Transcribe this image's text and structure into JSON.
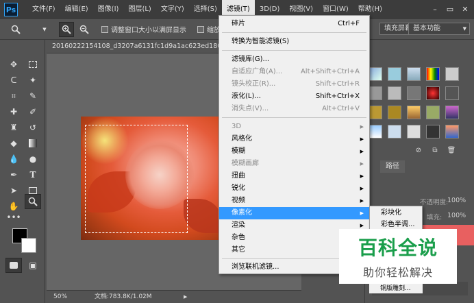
{
  "app": {
    "logo": "Ps"
  },
  "menubar": {
    "items": [
      "文件(F)",
      "编辑(E)",
      "图像(I)",
      "图层(L)",
      "文字(Y)",
      "选择(S)",
      "滤镜(T)",
      "3D(D)",
      "视图(V)",
      "窗口(W)",
      "帮助(H)"
    ],
    "active_index": 6
  },
  "options": {
    "resize_label": "调整窗口大小以满屏显示",
    "zoom_all_label": "缩放所有",
    "fill_screen_label": "填充屏幕",
    "workspace": "基本功能"
  },
  "document": {
    "tab_title": "20160222154108_d3207a6131fc1d9a1ac623ed180"
  },
  "status": {
    "zoom": "50%",
    "doc_info": "文档:783.8K/1.02M"
  },
  "filter_menu": {
    "last_filter": {
      "label": "碎片",
      "shortcut": "Ctrl+F"
    },
    "smart": "转换为智能滤镜(S)",
    "gallery": "滤镜库(G)...",
    "adaptive": {
      "label": "自适应广角(A)...",
      "shortcut": "Alt+Shift+Ctrl+A"
    },
    "lens": {
      "label": "镜头校正(R)...",
      "shortcut": "Shift+Ctrl+R"
    },
    "liquify": {
      "label": "液化(L)...",
      "shortcut": "Shift+Ctrl+X"
    },
    "vanish": {
      "label": "消失点(V)...",
      "shortcut": "Alt+Ctrl+V"
    },
    "categories": [
      "3D",
      "风格化",
      "模糊",
      "模糊画廊",
      "扭曲",
      "锐化",
      "视频",
      "像素化",
      "渲染",
      "杂色",
      "其它"
    ],
    "browse": "浏览联机滤镜..."
  },
  "submenu": {
    "items": [
      "彩块化",
      "彩色半调..."
    ]
  },
  "panels": {
    "paths_tab": "路径",
    "opacity_label": "不透明度:",
    "opacity_value": "100%",
    "fill_label": "填充:",
    "fill_value": "100%",
    "partial_item": "铜版雕刻..."
  },
  "watermark": {
    "title": "百科全说",
    "subtitle": "助你轻松解决"
  },
  "colors": {
    "accent": "#3399ff",
    "menu_bg": "#f0f0f0",
    "bar_bg": "#3c3c3c",
    "panel_bg": "#535353",
    "canvas_bg": "#666666",
    "watermark_green": "#1a9e4b"
  },
  "icons": [
    "zoom-icon",
    "zoom-in-icon",
    "zoom-out-icon",
    "move-icon",
    "marquee-icon",
    "lasso-icon",
    "magic-wand-icon",
    "crop-icon",
    "eyedropper-icon",
    "healing-icon",
    "brush-icon",
    "stamp-icon",
    "history-brush-icon",
    "eraser-icon",
    "gradient-icon",
    "blur-icon",
    "dodge-icon",
    "pen-icon",
    "type-icon",
    "path-select-icon",
    "shape-icon",
    "hand-icon",
    "more-tools-icon"
  ]
}
